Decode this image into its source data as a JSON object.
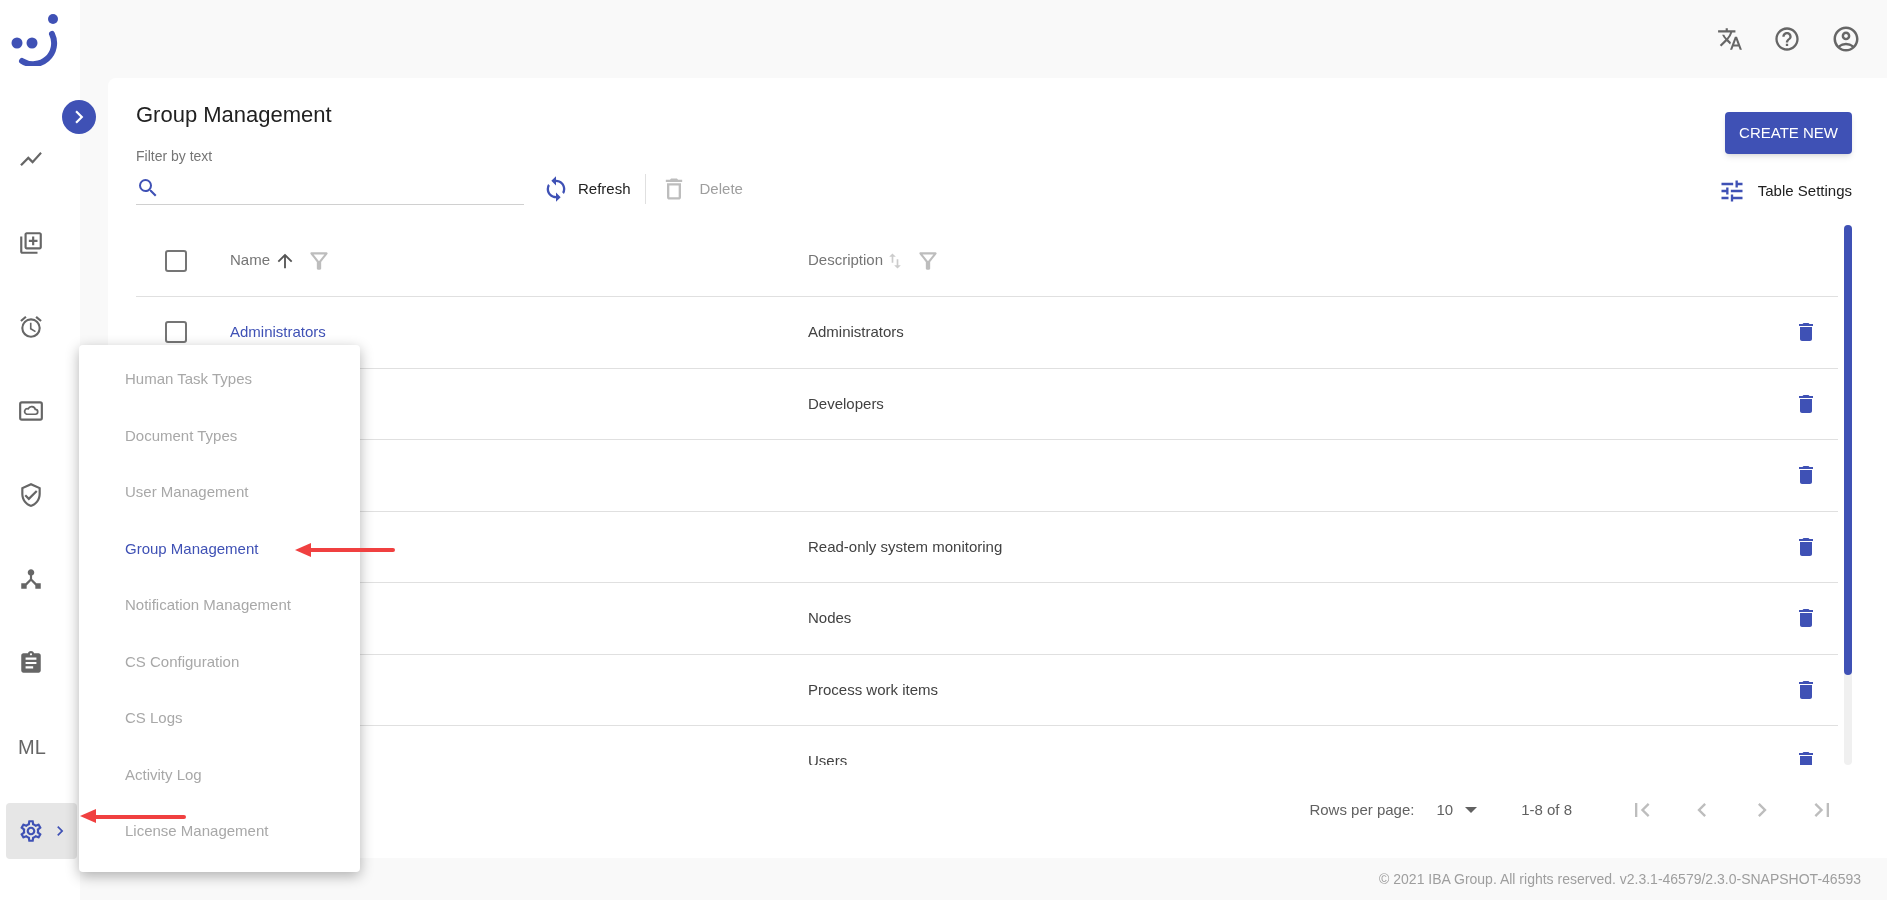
{
  "sidebar": {
    "items": [
      {
        "kind": "icon",
        "selected": false
      },
      {
        "kind": "icon",
        "selected": false
      },
      {
        "kind": "icon",
        "selected": false
      },
      {
        "kind": "icon",
        "selected": false
      },
      {
        "kind": "icon",
        "selected": false
      },
      {
        "kind": "icon",
        "selected": false
      },
      {
        "kind": "icon",
        "selected": false
      },
      {
        "kind": "text",
        "label": "ML",
        "selected": false
      },
      {
        "kind": "icon",
        "selected": true
      }
    ]
  },
  "page": {
    "title": "Group Management",
    "create_button": "CREATE NEW",
    "filter": {
      "label": "Filter by text"
    },
    "toolbar": {
      "refresh": {
        "label": "Refresh",
        "disabled": false
      },
      "delete": {
        "label": "Delete",
        "disabled": true
      },
      "table_settings": "Table Settings"
    }
  },
  "table": {
    "header_checked": false,
    "columns": [
      {
        "label": "Name",
        "sorted": true
      },
      {
        "label": "Description",
        "sorted": false
      }
    ],
    "rows": [
      {
        "name": "Administrators",
        "description": "Administrators",
        "checked": false
      },
      {
        "description": "Developers"
      },
      {},
      {
        "description": "Read-only system monitoring"
      },
      {
        "description": "Nodes"
      },
      {
        "description": "Process work items"
      },
      {
        "description": "Users"
      }
    ]
  },
  "pagination": {
    "rows_per_page_label": "Rows per page:",
    "rows_per_page": "10",
    "range": "1-8 of 8"
  },
  "footer": "© 2021 IBA Group. All rights reserved. v2.3.1-46579/2.3.0-SNAPSHOT-46593",
  "menu": {
    "items": [
      {
        "label": "Human Task Types",
        "selected": false
      },
      {
        "label": "Document Types",
        "selected": false
      },
      {
        "label": "User Management",
        "selected": false
      },
      {
        "label": "Group Management",
        "selected": true
      },
      {
        "label": "Notification Management",
        "selected": false
      },
      {
        "label": "CS Configuration",
        "selected": false
      },
      {
        "label": "CS Logs",
        "selected": false
      },
      {
        "label": "Activity Log",
        "selected": false
      },
      {
        "label": "License Management",
        "selected": false
      }
    ]
  }
}
